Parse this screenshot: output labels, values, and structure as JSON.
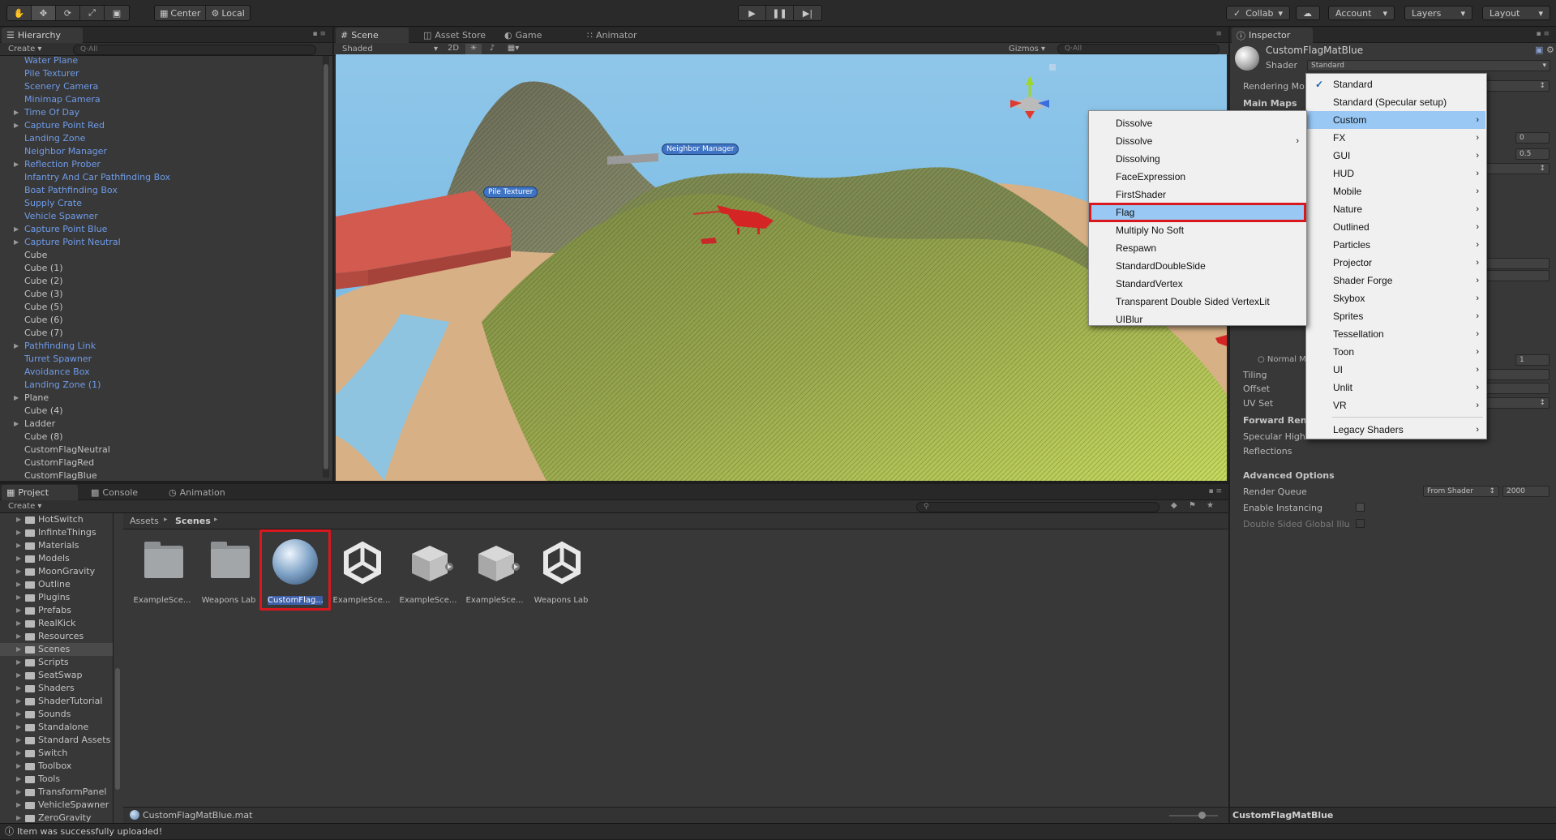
{
  "toolbar": {
    "pivot": "Center",
    "space": "Local",
    "collab": "Collab",
    "account": "Account",
    "layers": "Layers",
    "layout": "Layout"
  },
  "hierarchy": {
    "tab": "Hierarchy",
    "create": "Create",
    "search": "Q·All",
    "items": [
      {
        "label": "Water Plane",
        "blue": true,
        "arrow": false
      },
      {
        "label": "Pile Texturer",
        "blue": true,
        "arrow": false
      },
      {
        "label": "Scenery Camera",
        "blue": true,
        "arrow": false
      },
      {
        "label": "Minimap Camera",
        "blue": true,
        "arrow": false
      },
      {
        "label": "Time Of Day",
        "blue": true,
        "arrow": true
      },
      {
        "label": "Capture Point Red",
        "blue": true,
        "arrow": true
      },
      {
        "label": "Landing Zone",
        "blue": true,
        "arrow": false
      },
      {
        "label": "Neighbor Manager",
        "blue": true,
        "arrow": false
      },
      {
        "label": "Reflection Prober",
        "blue": true,
        "arrow": true
      },
      {
        "label": "Infantry And Car Pathfinding Box",
        "blue": true,
        "arrow": false
      },
      {
        "label": "Boat Pathfinding Box",
        "blue": true,
        "arrow": false
      },
      {
        "label": "Supply Crate",
        "blue": true,
        "arrow": false
      },
      {
        "label": "Vehicle Spawner",
        "blue": true,
        "arrow": false
      },
      {
        "label": "Capture Point Blue",
        "blue": true,
        "arrow": true
      },
      {
        "label": "Capture Point Neutral",
        "blue": true,
        "arrow": true
      },
      {
        "label": "Cube",
        "blue": false,
        "arrow": false
      },
      {
        "label": "Cube (1)",
        "blue": false,
        "arrow": false
      },
      {
        "label": "Cube (2)",
        "blue": false,
        "arrow": false
      },
      {
        "label": "Cube (3)",
        "blue": false,
        "arrow": false
      },
      {
        "label": "Cube (5)",
        "blue": false,
        "arrow": false
      },
      {
        "label": "Cube (6)",
        "blue": false,
        "arrow": false
      },
      {
        "label": "Cube (7)",
        "blue": false,
        "arrow": false
      },
      {
        "label": "Pathfinding Link",
        "blue": true,
        "arrow": true
      },
      {
        "label": "Turret Spawner",
        "blue": true,
        "arrow": false
      },
      {
        "label": "Avoidance Box",
        "blue": true,
        "arrow": false
      },
      {
        "label": "Landing Zone (1)",
        "blue": true,
        "arrow": false
      },
      {
        "label": "Plane",
        "blue": false,
        "arrow": true
      },
      {
        "label": "Cube (4)",
        "blue": false,
        "arrow": false
      },
      {
        "label": "Ladder",
        "blue": false,
        "arrow": true
      },
      {
        "label": "Cube (8)",
        "blue": false,
        "arrow": false
      },
      {
        "label": "CustomFlagNeutral",
        "blue": false,
        "arrow": false
      },
      {
        "label": "CustomFlagRed",
        "blue": false,
        "arrow": false
      },
      {
        "label": "CustomFlagBlue",
        "blue": false,
        "arrow": false
      }
    ]
  },
  "scene_tabs": {
    "scene": "Scene",
    "asset_store": "Asset Store",
    "game": "Game",
    "animator": "Animator",
    "shaded": "Shaded",
    "mode2d": "2D",
    "gizmos": "Gizmos",
    "search": "Q·All"
  },
  "scene_labels": {
    "neighbor": "Neighbor Manager",
    "pile": "Pile Texturer"
  },
  "inspector": {
    "tab": "Inspector",
    "material_name": "CustomFlagMatBlue",
    "shader_label": "Shader",
    "shader_value": "Standard",
    "rendering_mode": "Rendering Mo",
    "main_maps": "Main Maps",
    "normal": "Normal M",
    "tiling": "Tiling",
    "offset": "Offset",
    "uv_set": "UV Set",
    "forward_ren": "Forward Ren",
    "specular": "Specular High",
    "reflections": "Reflections",
    "advanced": "Advanced Options",
    "render_queue": "Render Queue",
    "from_shader": "From Shader",
    "queue_value": "2000",
    "enable_instancing": "Enable Instancing",
    "double_sided": "Double Sided Global Illu",
    "val_0": "0",
    "val_05": "0.5",
    "val_1": "1",
    "footer": "CustomFlagMatBlue"
  },
  "shader_menu": [
    {
      "label": "Standard",
      "check": true,
      "sub": false
    },
    {
      "label": "Standard (Specular setup)",
      "check": false,
      "sub": false
    },
    {
      "label": "Custom",
      "check": false,
      "sub": true,
      "hl": true
    },
    {
      "label": "FX",
      "check": false,
      "sub": true
    },
    {
      "label": "GUI",
      "check": false,
      "sub": true
    },
    {
      "label": "HUD",
      "check": false,
      "sub": true
    },
    {
      "label": "Mobile",
      "check": false,
      "sub": true
    },
    {
      "label": "Nature",
      "check": false,
      "sub": true
    },
    {
      "label": "Outlined",
      "check": false,
      "sub": true
    },
    {
      "label": "Particles",
      "check": false,
      "sub": true
    },
    {
      "label": "Projector",
      "check": false,
      "sub": true
    },
    {
      "label": "Shader Forge",
      "check": false,
      "sub": true
    },
    {
      "label": "Skybox",
      "check": false,
      "sub": true
    },
    {
      "label": "Sprites",
      "check": false,
      "sub": true
    },
    {
      "label": "Tessellation",
      "check": false,
      "sub": true
    },
    {
      "label": "Toon",
      "check": false,
      "sub": true
    },
    {
      "label": "UI",
      "check": false,
      "sub": true
    },
    {
      "label": "Unlit",
      "check": false,
      "sub": true
    },
    {
      "label": "VR",
      "check": false,
      "sub": true
    },
    {
      "label": "Legacy Shaders",
      "check": false,
      "sub": true
    }
  ],
  "custom_menu": [
    {
      "label": "Dissolve",
      "sub": false
    },
    {
      "label": "Dissolve",
      "sub": true
    },
    {
      "label": "Dissolving",
      "sub": false
    },
    {
      "label": "FaceExpression",
      "sub": false
    },
    {
      "label": "FirstShader",
      "sub": false
    },
    {
      "label": "Flag",
      "sub": false,
      "selected": true
    },
    {
      "label": "Multiply No Soft",
      "sub": false
    },
    {
      "label": "Respawn",
      "sub": false
    },
    {
      "label": "StandardDoubleSide",
      "sub": false
    },
    {
      "label": "StandardVertex",
      "sub": false
    },
    {
      "label": "Transparent Double Sided VertexLit",
      "sub": false
    },
    {
      "label": "UIBlur",
      "sub": false
    }
  ],
  "bottom_tabs": {
    "project": "Project",
    "console": "Console",
    "animation": "Animation",
    "create": "Create"
  },
  "project": {
    "folders": [
      "HotSwitch",
      "InfinteThings",
      "Materials",
      "Models",
      "MoonGravity",
      "Outline",
      "Plugins",
      "Prefabs",
      "RealKick",
      "Resources",
      "Scenes",
      "Scripts",
      "SeatSwap",
      "Shaders",
      "ShaderTutorial",
      "Sounds",
      "Standalone",
      "Standard Assets",
      "Switch",
      "Toolbox",
      "Tools",
      "TransformPanel",
      "VehicleSpawner",
      "ZeroGravity"
    ],
    "breadcrumb_root": "Assets",
    "breadcrumb_current": "Scenes",
    "assets": [
      {
        "name": "ExampleSce...",
        "kind": "folder"
      },
      {
        "name": "Weapons Lab",
        "kind": "folder"
      },
      {
        "name": "CustomFlag...",
        "kind": "material",
        "selected": true
      },
      {
        "name": "ExampleSce...",
        "kind": "unity"
      },
      {
        "name": "ExampleSce...",
        "kind": "prefab"
      },
      {
        "name": "ExampleSce...",
        "kind": "prefab"
      },
      {
        "name": "Weapons Lab",
        "kind": "unity"
      }
    ],
    "footer_file": "CustomFlagMatBlue.mat"
  },
  "status": "Item was successfully uploaded!",
  "colors": {
    "highlight_red": "#d8181e",
    "menu_highlight": "#99c8f5",
    "prefab_blue": "#6f9be8"
  }
}
